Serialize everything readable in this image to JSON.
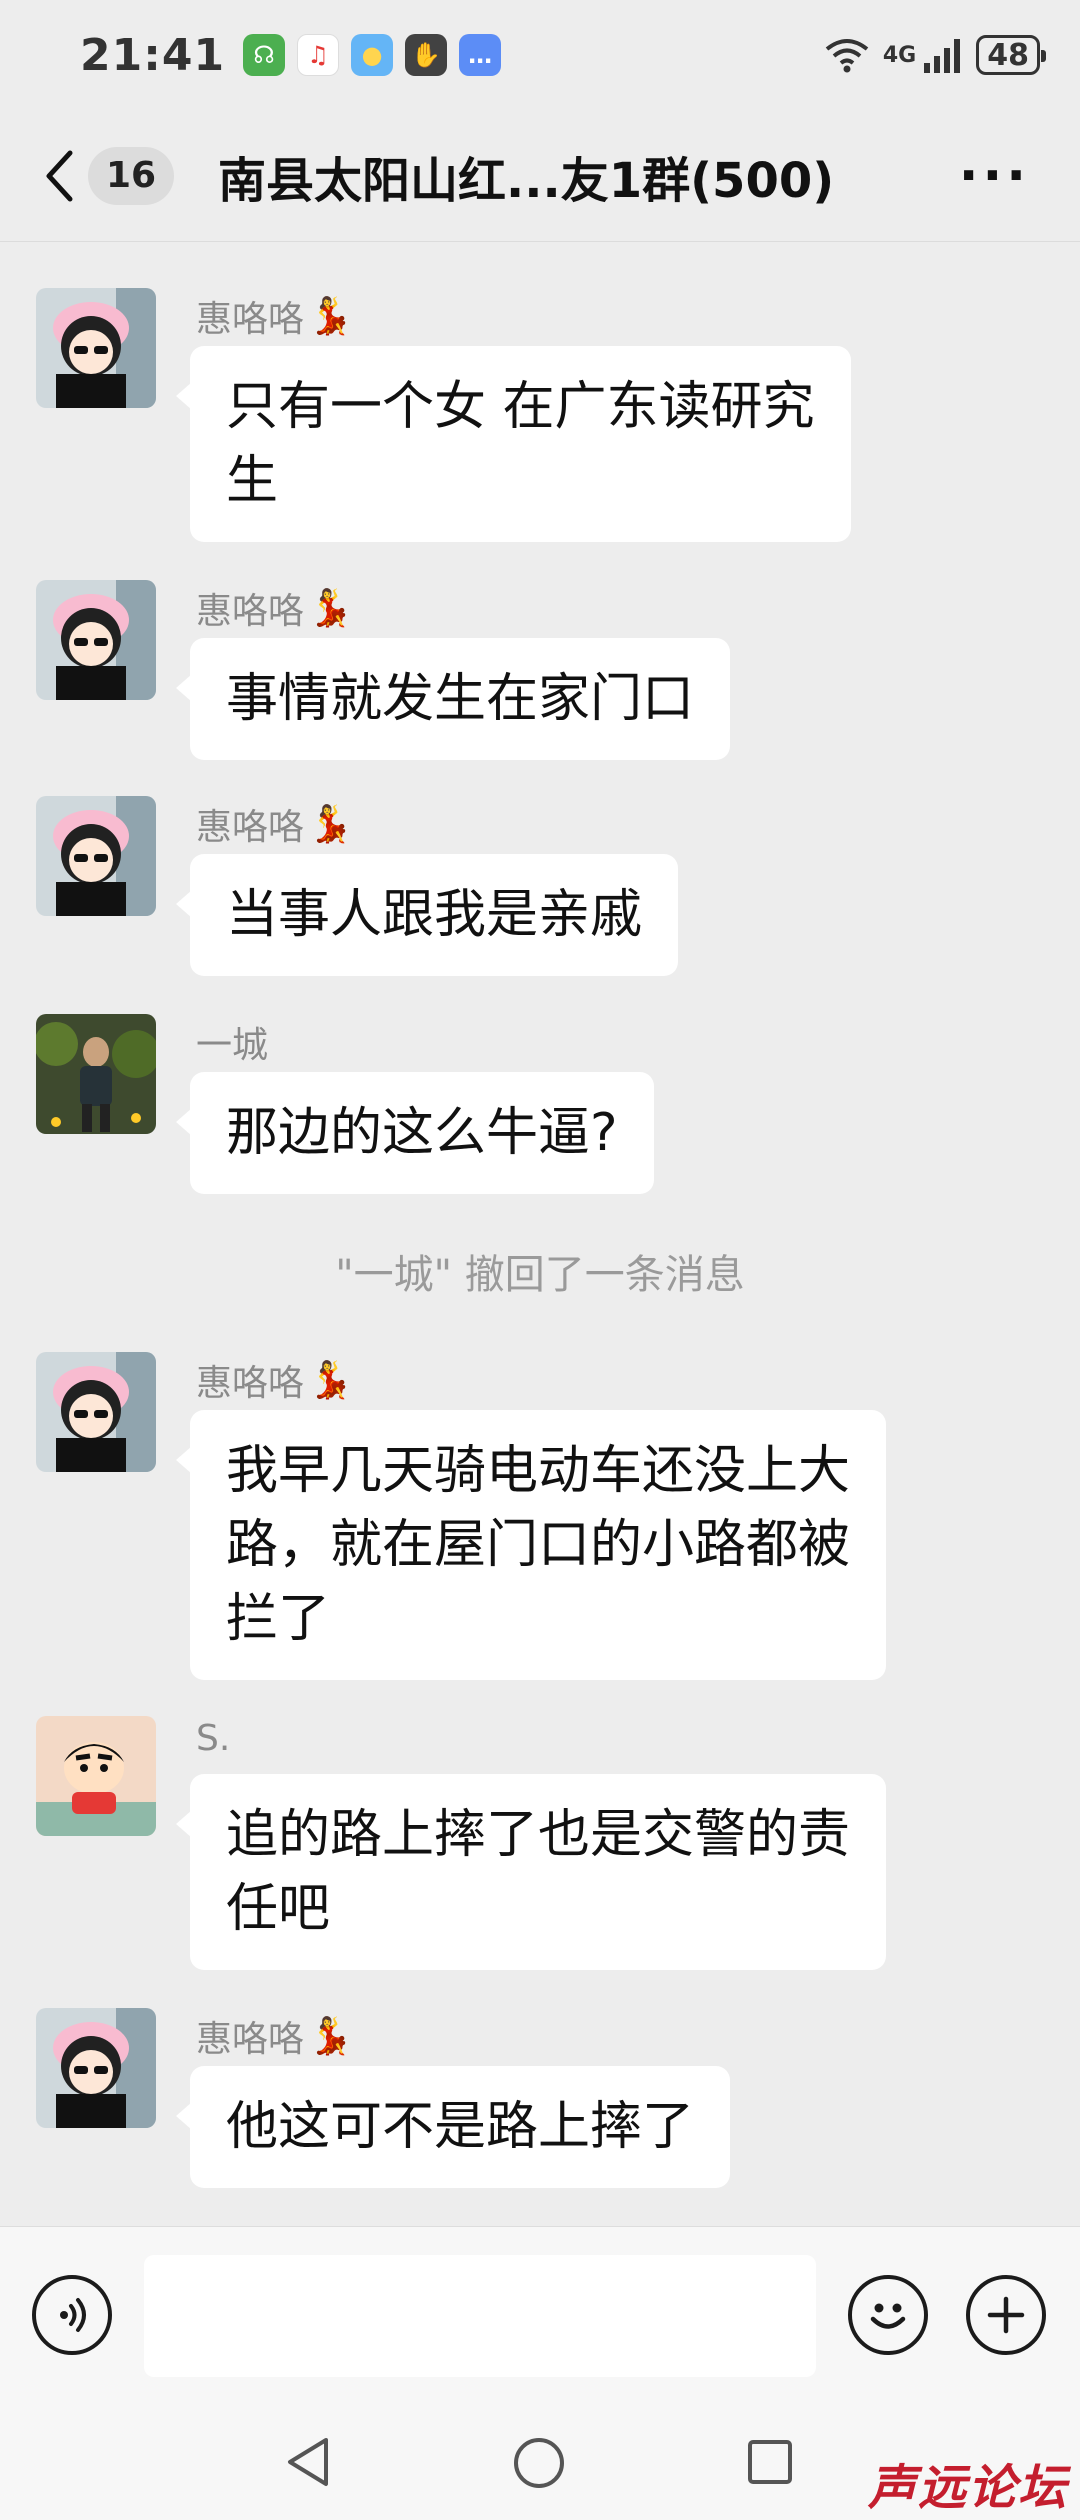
{
  "status_bar": {
    "time": "21:41",
    "network": "4G",
    "battery": "48",
    "notification_icons": [
      "fingerprint-app-icon",
      "music-app-icon",
      "weather-app-icon",
      "hand-app-icon",
      "message-app-icon"
    ]
  },
  "header": {
    "unread_count": "16",
    "title": "南县太阳山红...友1群(500)",
    "more": "···"
  },
  "messages": [
    {
      "type": "message",
      "sender": "惠咯咯",
      "sender_deco": "💃",
      "text_lines": [
        "只有一个女 在广东读研究",
        "生"
      ],
      "avatar": "girl-avatar"
    },
    {
      "type": "message",
      "sender": "惠咯咯",
      "sender_deco": "💃",
      "text_lines": [
        "事情就发生在家门口"
      ],
      "avatar": "girl-avatar"
    },
    {
      "type": "message",
      "sender": "惠咯咯",
      "sender_deco": "💃",
      "text_lines": [
        "当事人跟我是亲戚"
      ],
      "avatar": "girl-avatar"
    },
    {
      "type": "message",
      "sender": "一城",
      "sender_deco": "",
      "text_lines": [
        "那边的这么牛逼?"
      ],
      "avatar": "man-avatar"
    },
    {
      "type": "system",
      "text": "\"一城\" 撤回了一条消息"
    },
    {
      "type": "message",
      "sender": "惠咯咯",
      "sender_deco": "💃",
      "text_lines": [
        "我早几天骑电动车还没上大",
        "路，就在屋门口的小路都被",
        "拦了"
      ],
      "avatar": "girl-avatar"
    },
    {
      "type": "message",
      "sender": "S.",
      "sender_deco": "",
      "text_lines": [
        "追的路上摔了也是交警的责",
        "任吧"
      ],
      "avatar": "cartoon-avatar"
    },
    {
      "type": "message",
      "sender": "惠咯咯",
      "sender_deco": "💃",
      "text_lines": [
        "他这可不是路上摔了"
      ],
      "avatar": "girl-avatar"
    }
  ],
  "input_bar": {
    "placeholder": ""
  },
  "watermark": "声远论坛",
  "colors": {
    "background": "#ededed",
    "bubble": "#ffffff",
    "watermark": "#c41e2e"
  }
}
